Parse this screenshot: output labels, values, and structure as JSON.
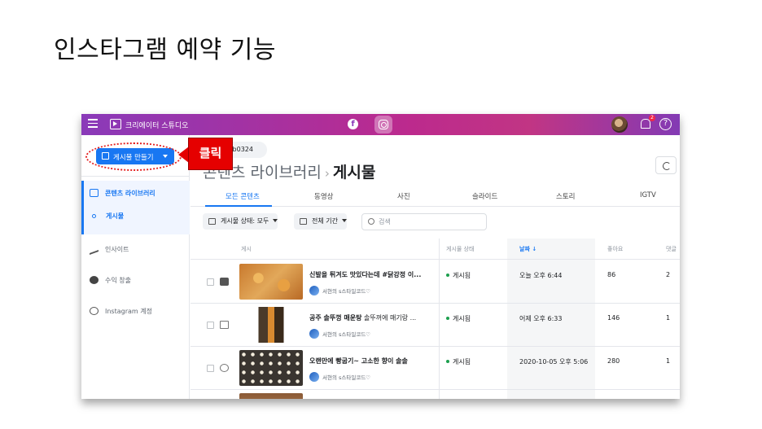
{
  "slide": {
    "title": "인스타그램 예약 기능"
  },
  "topbar": {
    "app_title": "크리에이터 스튜디오",
    "facebook_icon": "facebook-icon",
    "instagram_icon": "instagram-icon",
    "notification_count": "2",
    "help_label": "?"
  },
  "sidebar": {
    "create_button": "게시물 만들기",
    "items": [
      {
        "label": "콘텐츠 라이브러리",
        "icon": "library-icon"
      },
      {
        "label": "게시물",
        "icon": "dot-icon"
      },
      {
        "label": "인사이트",
        "icon": "insights-icon"
      },
      {
        "label": "수익 창출",
        "icon": "monetization-icon"
      },
      {
        "label": "Instagram 계정",
        "icon": "instagram-account-icon"
      }
    ]
  },
  "main": {
    "account": "gjib0324",
    "breadcrumb_parent": "콘텐츠 라이브러리",
    "breadcrumb_sep": "›",
    "breadcrumb_current": "게시물",
    "tabs": [
      "모든 콘텐츠",
      "동영상",
      "사진",
      "슬라이드",
      "스토리",
      "IGTV"
    ],
    "filters": {
      "status": "게시물 상태: 모두",
      "period": "전체 기간",
      "search_placeholder": "검색"
    },
    "columns": {
      "post": "게시",
      "status": "게시물 상태",
      "date": "날짜 ↓",
      "likes": "좋아요",
      "comments": "댓글"
    },
    "rows": [
      {
        "title": "신발을 튀겨도 맛있다는데 #닭강정 이...",
        "title_rest": "",
        "author": "서현의 s스타일코드♡",
        "status": "게시됨",
        "date": "오늘 오후 6:44",
        "likes": "86",
        "comments": "2"
      },
      {
        "title": "공주 솔뚜껑 매운탕",
        "title_rest": " 솔뚜꺼에 매기랑 ...",
        "author": "서현의 s스타일코드♡",
        "status": "게시됨",
        "date": "어제 오후 6:33",
        "likes": "146",
        "comments": "1"
      },
      {
        "title": "오랜만에 빵굽기~ 고소한 향이 솔솔",
        "title_rest": "",
        "author": "서현의 s스타일코드♡",
        "status": "게시됨",
        "date": "2020-10-05 오후 5:06",
        "likes": "280",
        "comments": "1"
      }
    ]
  },
  "callout": {
    "label": "클릭"
  },
  "colors": {
    "accent": "#1877f2",
    "callout": "#e50000",
    "topbar_start": "#8a3ab9",
    "topbar_end": "#833ab4"
  }
}
